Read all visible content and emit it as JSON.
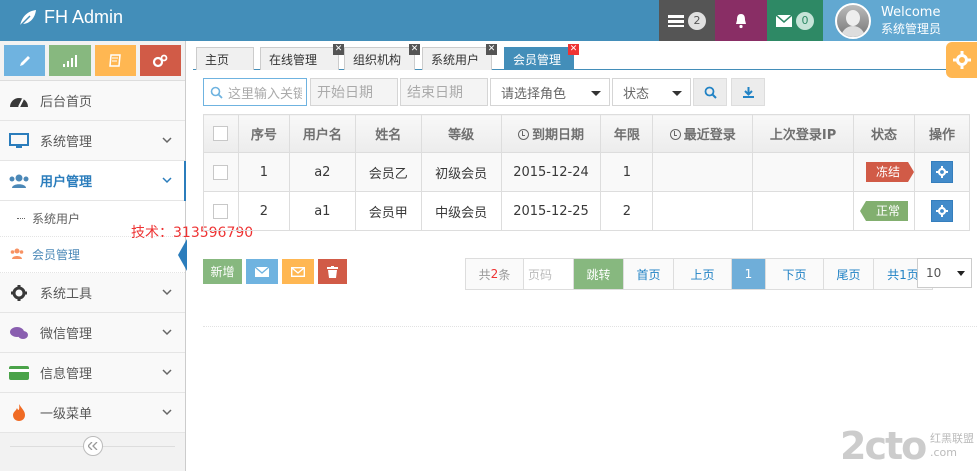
{
  "app": {
    "title": "FH Admin"
  },
  "header": {
    "tasks_count": "2",
    "messages_count": "0",
    "welcome": "Welcome",
    "username": "系统管理员"
  },
  "sidebar": {
    "items": [
      {
        "label": "后台首页"
      },
      {
        "label": "系统管理"
      },
      {
        "label": "用户管理"
      },
      {
        "label": "系统工具"
      },
      {
        "label": "微信管理"
      },
      {
        "label": "信息管理"
      },
      {
        "label": "一级菜单"
      }
    ],
    "sub_items": [
      {
        "label": "系统用户"
      },
      {
        "label": "会员管理"
      }
    ],
    "watermark": "技术：313596790"
  },
  "tabs": [
    {
      "label": "主页"
    },
    {
      "label": "在线管理"
    },
    {
      "label": "组织机构"
    },
    {
      "label": "系统用户"
    },
    {
      "label": "会员管理"
    }
  ],
  "search": {
    "keyword_placeholder": "这里输入关键词",
    "start_date_placeholder": "开始日期",
    "end_date_placeholder": "结束日期",
    "role_select": "请选择角色",
    "status_select": "状态"
  },
  "table": {
    "headers": [
      "序号",
      "用户名",
      "姓名",
      "等级",
      "到期日期",
      "年限",
      "最近登录",
      "上次登录IP",
      "状态",
      "操作"
    ],
    "rows": [
      {
        "index": "1",
        "username": "a2",
        "name": "会员乙",
        "level": "初级会员",
        "expire": "2015-12-24",
        "years": "1",
        "last_login": "",
        "last_ip": "",
        "status": "冻结"
      },
      {
        "index": "2",
        "username": "a1",
        "name": "会员甲",
        "level": "中级会员",
        "expire": "2015-12-25",
        "years": "2",
        "last_login": "",
        "last_ip": "",
        "status": "正常"
      }
    ]
  },
  "actions": {
    "add_label": "新增"
  },
  "pager": {
    "total_prefix": "共",
    "total_count": "2",
    "total_suffix": "条",
    "page_input_placeholder": "页码",
    "jump": "跳转",
    "first": "首页",
    "prev": "上页",
    "current": "1",
    "next": "下页",
    "last": "尾页",
    "total_pages": "共1页",
    "page_size": "10"
  },
  "corner_logo": {
    "main": "2cto",
    "line1": "红黑联盟",
    "line2": ".com"
  },
  "colors": {
    "navbar": "#438eb9",
    "success": "#87b87f",
    "info": "#6fb3e0",
    "warning": "#ffb752",
    "danger": "#d15b47"
  }
}
